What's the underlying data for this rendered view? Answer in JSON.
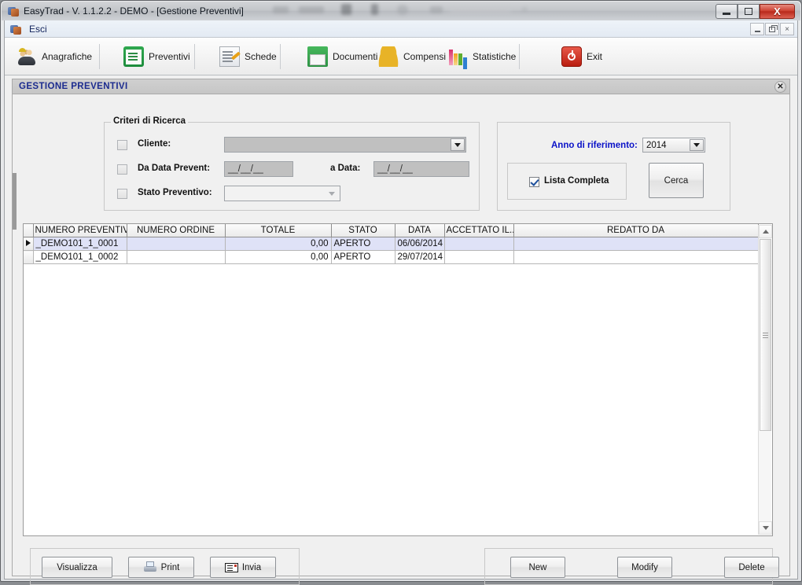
{
  "window": {
    "title": "EasyTrad - V. 1.1.2.2 - DEMO - [Gestione Preventivi]",
    "app_icon": "app-icon",
    "minimize_label": "Minimize",
    "maximize_label": "Maximize",
    "close_label": "X"
  },
  "menubar": {
    "icon": "app-icon",
    "items": [
      {
        "label": "Esci"
      }
    ],
    "child_minimize": "_",
    "child_restore": "Restore",
    "child_close": "×"
  },
  "toolbar": {
    "items": [
      {
        "label": "Anagrafiche",
        "icon": "people-icon"
      },
      {
        "label": "Preventivi",
        "icon": "clipboard-icon"
      },
      {
        "label": "Schede",
        "icon": "sheet-pencil-icon"
      },
      {
        "label": "Documenti",
        "icon": "document-box-icon"
      },
      {
        "label": "Compensi",
        "icon": "coins-icon"
      },
      {
        "label": "Statistiche",
        "icon": "bar-chart-icon"
      },
      {
        "label": "Exit",
        "icon": "power-exit-icon"
      }
    ]
  },
  "form": {
    "header_title": "GESTIONE PREVENTIVI",
    "header_close": "✕"
  },
  "search": {
    "legend": "Criteri di Ricerca",
    "cliente": {
      "label": "Cliente:",
      "checked": false,
      "value": "",
      "placeholder": ""
    },
    "da_data": {
      "label": "Da Data Prevent:",
      "checked": false,
      "value": "__/__/__"
    },
    "a_data": {
      "label": "a Data:",
      "value": "__/__/__"
    },
    "stato": {
      "label": "Stato Preventivo:",
      "checked": false,
      "value": ""
    }
  },
  "anno": {
    "label": "Anno di riferimento:",
    "value": "2014",
    "lista_completa_label": "Lista Completa",
    "lista_completa_checked": true,
    "cerca_label": "Cerca"
  },
  "grid": {
    "columns": [
      "NUMERO PREVENTIVO",
      "NUMERO ORDINE",
      "TOTALE",
      "STATO",
      "DATA",
      "ACCETTATO IL...",
      "REDATTO DA"
    ],
    "rows": [
      {
        "selected": true,
        "marker": "▶",
        "numero_preventivo": "_DEMO101_1_0001",
        "numero_ordine": "",
        "totale": "0,00",
        "stato": "APERTO",
        "data": "06/06/2014",
        "accettato_il": "",
        "redatto_da": ""
      },
      {
        "selected": false,
        "marker": "",
        "numero_preventivo": "_DEMO101_1_0002",
        "numero_ordine": "",
        "totale": "0,00",
        "stato": "APERTO",
        "data": "29/07/2014",
        "accettato_il": "",
        "redatto_da": ""
      }
    ]
  },
  "actions": {
    "left": [
      {
        "label": "Visualizza",
        "icon": ""
      },
      {
        "label": "Print",
        "icon": "printer-icon"
      },
      {
        "label": "Invia",
        "icon": "mail-icon"
      }
    ],
    "right": [
      {
        "label": "New"
      },
      {
        "label": "Modify"
      },
      {
        "label": "Delete"
      }
    ]
  },
  "colors": {
    "accent_blue": "#1c2c8f",
    "label_blue": "#0a12c8",
    "selection_row": "#dfe2f7",
    "close_red": "#cf4434"
  }
}
